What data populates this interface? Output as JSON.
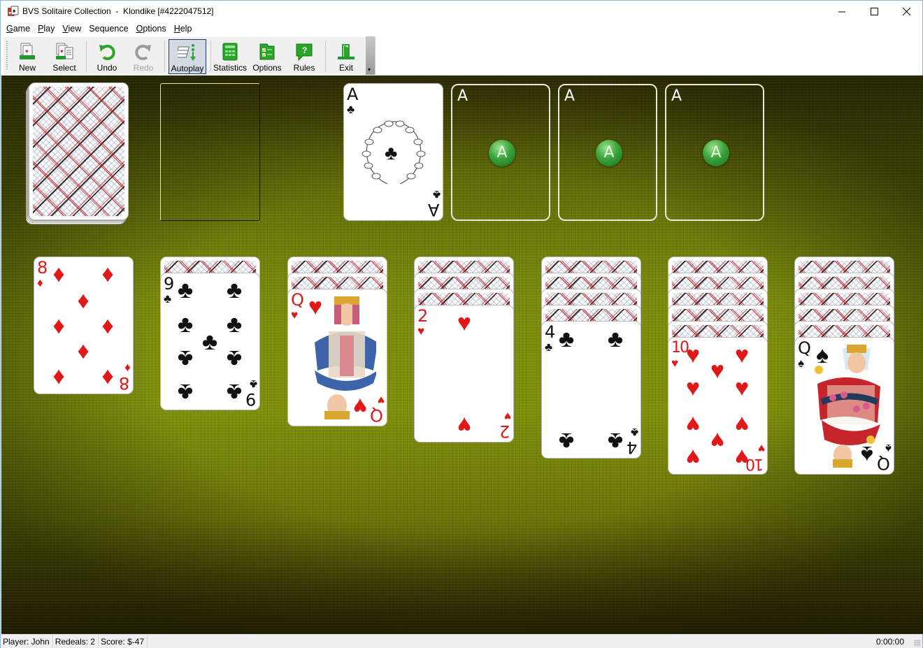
{
  "window": {
    "title": "BVS Solitaire Collection  -  Klondike [#4222047512]",
    "controls": {
      "minimize": "—",
      "maximize": "☐",
      "close": "✕"
    }
  },
  "menu": [
    {
      "label_ul": "G",
      "label_rest": "ame"
    },
    {
      "label_ul": "P",
      "label_rest": "lay"
    },
    {
      "label_ul": "V",
      "label_rest": "iew"
    },
    {
      "label_ul": "",
      "label_rest": "Sequence"
    },
    {
      "label_ul": "O",
      "label_rest": "ptions"
    },
    {
      "label_ul": "H",
      "label_rest": "elp"
    }
  ],
  "toolbar": {
    "buttons": [
      {
        "id": "new",
        "label": "New",
        "icon": "new-game-icon",
        "enabled": true,
        "pressed": false
      },
      {
        "id": "select",
        "label": "Select",
        "icon": "select-game-icon",
        "enabled": true,
        "pressed": false
      },
      {
        "id": "undo",
        "label": "Undo",
        "icon": "undo-icon",
        "enabled": true,
        "pressed": false
      },
      {
        "id": "redo",
        "label": "Redo",
        "icon": "redo-icon",
        "enabled": false,
        "pressed": false
      },
      {
        "id": "autoplay",
        "label": "Autoplay",
        "icon": "autoplay-icon",
        "enabled": true,
        "pressed": true
      },
      {
        "id": "statistics",
        "label": "Statistics",
        "icon": "statistics-icon",
        "enabled": true,
        "pressed": false
      },
      {
        "id": "options",
        "label": "Options",
        "icon": "options-icon",
        "enabled": true,
        "pressed": false
      },
      {
        "id": "rules",
        "label": "Rules",
        "icon": "rules-icon",
        "enabled": true,
        "pressed": false
      },
      {
        "id": "exit",
        "label": "Exit",
        "icon": "exit-icon",
        "enabled": true,
        "pressed": false
      }
    ],
    "overflow_glyph": "▾"
  },
  "game": {
    "name": "Klondike",
    "stock": {
      "face_down": true,
      "has_cards": true
    },
    "waste": {
      "empty": true
    },
    "foundations": [
      {
        "top_card": {
          "rank": "A",
          "suit": "♣",
          "color": "black"
        }
      },
      {
        "empty": true,
        "placeholder": "A"
      },
      {
        "empty": true,
        "placeholder": "A"
      },
      {
        "empty": true,
        "placeholder": "A"
      }
    ],
    "empty_foundation_badge": "A",
    "tableau": [
      {
        "face_down": 0,
        "top": {
          "rank": "8",
          "suit": "♦",
          "color": "red"
        }
      },
      {
        "face_down": 1,
        "top": {
          "rank": "9",
          "suit": "♣",
          "color": "black"
        }
      },
      {
        "face_down": 2,
        "top": {
          "rank": "Q",
          "suit": "♥",
          "color": "red"
        }
      },
      {
        "face_down": 3,
        "top": {
          "rank": "2",
          "suit": "♥",
          "color": "red"
        }
      },
      {
        "face_down": 4,
        "top": {
          "rank": "4",
          "suit": "♣",
          "color": "black"
        }
      },
      {
        "face_down": 5,
        "top": {
          "rank": "10",
          "suit": "♥",
          "color": "red"
        }
      },
      {
        "face_down": 5,
        "top": {
          "rank": "Q",
          "suit": "♠",
          "color": "black"
        }
      }
    ]
  },
  "status": {
    "player": "Player: John",
    "redeals": "Redeals: 2",
    "score": "Score: $-47",
    "time": "0:00:00"
  },
  "colors": {
    "felt": "#7a8a0c",
    "red_suit": "#e01818",
    "accent_green": "#3aa53a"
  }
}
